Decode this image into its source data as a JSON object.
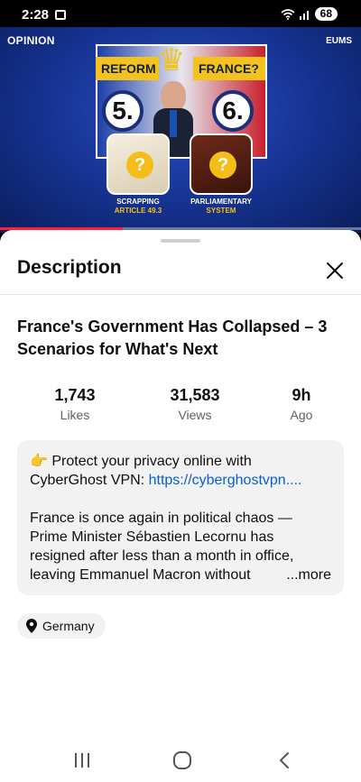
{
  "status_bar": {
    "time": "2:28",
    "battery": "68"
  },
  "video": {
    "corner_left": "OPINION",
    "corner_right": "EUMS",
    "banner_left": "REFORM",
    "banner_right": "FRANCE?",
    "number_left": "5.",
    "number_right": "6.",
    "tile_left_caption": "SCRAPPING",
    "tile_left_sub": "ARTICLE 49.3",
    "tile_right_caption": "PARLIAMENTARY",
    "tile_right_sub": "SYSTEM",
    "tile_mark": "?",
    "progress_fraction": 0.34,
    "accent": "#ff1f3d"
  },
  "sheet": {
    "header": "Description",
    "close_icon": "close-icon",
    "video_title": "France's Government Has Collapsed – 3 Scenarios for What's Next",
    "stats": [
      {
        "value": "1,743",
        "label": "Likes"
      },
      {
        "value": "31,583",
        "label": "Views"
      },
      {
        "value": "9h",
        "label": "Ago"
      }
    ],
    "description": {
      "emoji": "👉",
      "promo_text": "Protect your privacy online with CyberGhost VPN: ",
      "promo_link": "https://cyberghostvpn....",
      "body": "France is once again in political chaos — Prime Minister Sébastien Lecornu has resigned after less than a month in office, leaving Emmanuel Macron without",
      "more_label": "...more"
    },
    "location_chip": "Germany",
    "link_color": "#065fd4"
  }
}
